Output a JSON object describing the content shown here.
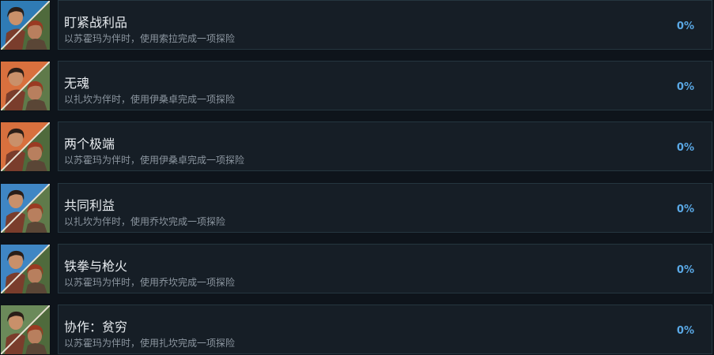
{
  "achievements": [
    {
      "title": "盯紧战利品",
      "description": "以苏霍玛为伴时，使用索拉完成一项探险",
      "progress": "0%",
      "icon": "character-pair-portrait-icon",
      "left_bg": "#2f7bb5",
      "right_bg": "#4f6a3c"
    },
    {
      "title": "无魂",
      "description": "以扎坎为伴时，使用伊桑卓完成一项探险",
      "progress": "0%",
      "icon": "character-pair-portrait-icon",
      "left_bg": "#d8703e",
      "right_bg": "#5f7a4a"
    },
    {
      "title": "两个极端",
      "description": "以苏霍玛为伴时，使用伊桑卓完成一项探险",
      "progress": "0%",
      "icon": "character-pair-portrait-icon",
      "left_bg": "#d8703e",
      "right_bg": "#4f6a3c"
    },
    {
      "title": "共同利益",
      "description": "以扎坎为伴时，使用乔坎完成一项探险",
      "progress": "0%",
      "icon": "character-pair-portrait-icon",
      "left_bg": "#3f86c4",
      "right_bg": "#5f7a4a"
    },
    {
      "title": "铁拳与枪火",
      "description": "以苏霍玛为伴时，使用乔坎完成一项探险",
      "progress": "0%",
      "icon": "character-pair-portrait-icon",
      "left_bg": "#3f86c4",
      "right_bg": "#4f6a3c"
    },
    {
      "title": "协作：贫穷",
      "description": "以苏霍玛为伴时，使用扎坎完成一项探险",
      "progress": "0%",
      "icon": "character-pair-portrait-icon",
      "left_bg": "#6b8a5a",
      "right_bg": "#4f6a3c"
    }
  ]
}
